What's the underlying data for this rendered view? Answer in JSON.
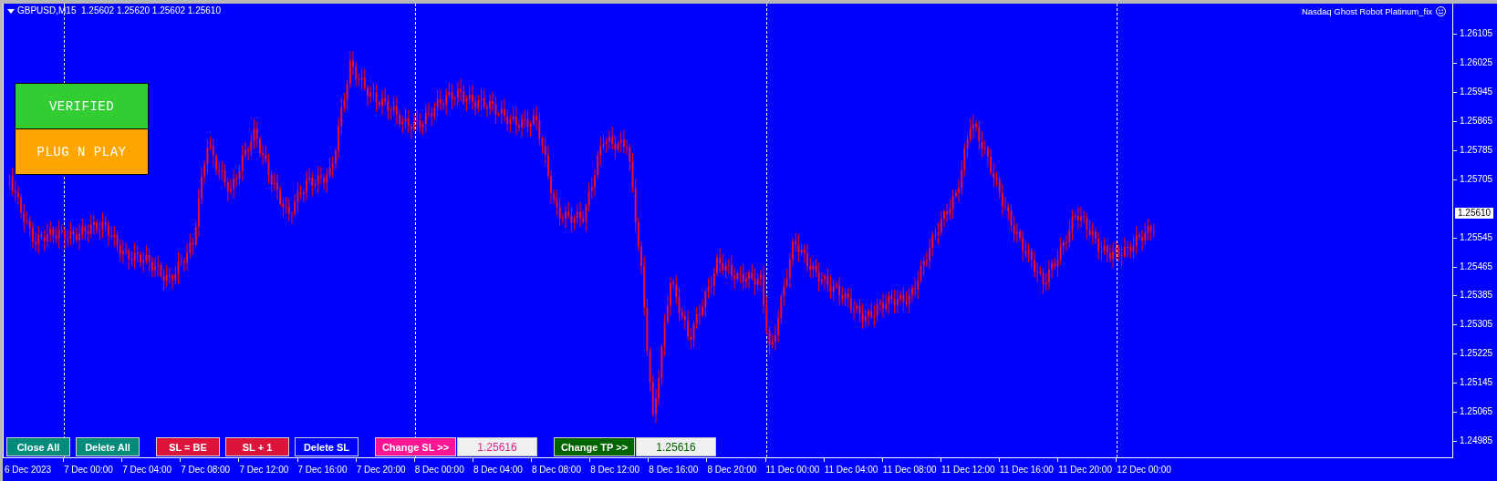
{
  "chart": {
    "symbol_line": "GBPUSD,M15  1.25602 1.25620 1.25602 1.25610",
    "expert_name": "Nasdaq Ghost Robot Platinum_fix",
    "panels": [
      {
        "label": "VERIFIED",
        "color": "#32cd32"
      },
      {
        "label": "PLUG N PLAY",
        "color": "#ffa500"
      }
    ],
    "control_groups": [
      [
        {
          "kind": "button",
          "label": "Close All",
          "color": "#008b7b"
        },
        {
          "kind": "button",
          "label": "Delete All",
          "color": "#008b7b"
        }
      ],
      [
        {
          "kind": "button",
          "label": "SL = BE",
          "color": "#dc143c"
        },
        {
          "kind": "button",
          "label": "SL + 1",
          "color": "#dc143c"
        },
        {
          "kind": "button",
          "label": "Delete SL",
          "color": "#0000ff"
        }
      ],
      [
        {
          "kind": "button",
          "label": "Change SL >>",
          "color": "#ff1493"
        },
        {
          "kind": "field",
          "value": "1.25616",
          "color": "#e0218a"
        }
      ],
      [
        {
          "kind": "button",
          "label": "Change TP >>",
          "color": "#006400"
        },
        {
          "kind": "field",
          "value": "1.25616",
          "color": "#006400"
        }
      ]
    ],
    "price_axis": [
      "1.26105",
      "1.26025",
      "1.25945",
      "1.25865",
      "1.25785",
      "1.25705",
      "1.25545",
      "1.25465",
      "1.25385",
      "1.25305",
      "1.25225",
      "1.25145",
      "1.25065",
      "1.24985"
    ],
    "current_price": "1.25610",
    "time_axis": [
      {
        "label": "6 Dec 2023",
        "day_start": false
      },
      {
        "label": "7 Dec 00:00",
        "day_start": true
      },
      {
        "label": "7 Dec 04:00",
        "day_start": false
      },
      {
        "label": "7 Dec 08:00",
        "day_start": false
      },
      {
        "label": "7 Dec 12:00",
        "day_start": false
      },
      {
        "label": "7 Dec 16:00",
        "day_start": false
      },
      {
        "label": "7 Dec 20:00",
        "day_start": false
      },
      {
        "label": "8 Dec 00:00",
        "day_start": true
      },
      {
        "label": "8 Dec 04:00",
        "day_start": false
      },
      {
        "label": "8 Dec 08:00",
        "day_start": false
      },
      {
        "label": "8 Dec 12:00",
        "day_start": false
      },
      {
        "label": "8 Dec 16:00",
        "day_start": false
      },
      {
        "label": "8 Dec 20:00",
        "day_start": false
      },
      {
        "label": "11 Dec 00:00",
        "day_start": true
      },
      {
        "label": "11 Dec 04:00",
        "day_start": false
      },
      {
        "label": "11 Dec 08:00",
        "day_start": false
      },
      {
        "label": "11 Dec 12:00",
        "day_start": false
      },
      {
        "label": "11 Dec 16:00",
        "day_start": false
      },
      {
        "label": "11 Dec 20:00",
        "day_start": false
      },
      {
        "label": "12 Dec 00:00",
        "day_start": true
      }
    ]
  }
}
